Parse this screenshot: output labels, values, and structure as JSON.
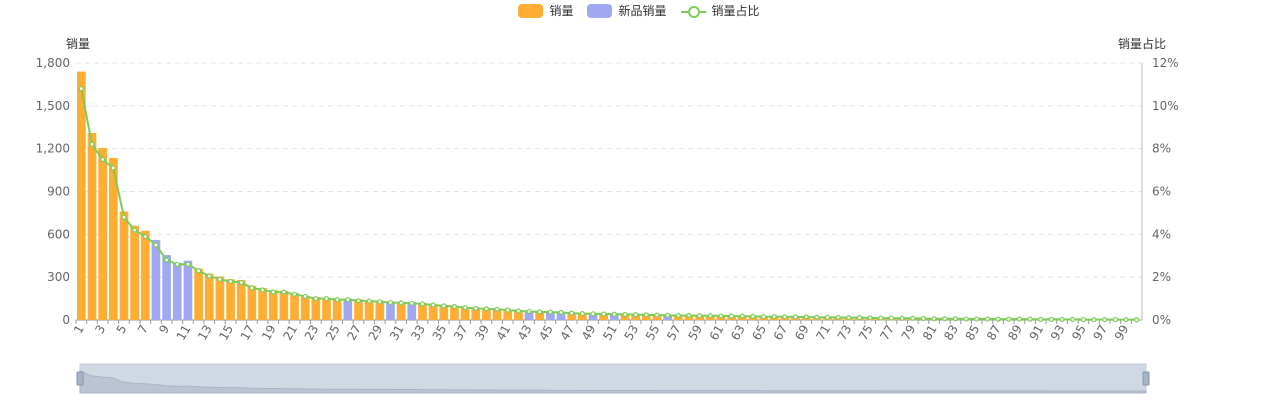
{
  "legend": {
    "sales_label": "销量",
    "new_sales_label": "新品销量",
    "ratio_label": "销量占比"
  },
  "colors": {
    "sales": "#FFAD33",
    "new_sales": "#9FA8F0",
    "ratio": "#7CCD57"
  },
  "chart_data": {
    "type": "bar",
    "title": "",
    "ylabel": "销量",
    "y2label": "销量占比",
    "ylim": [
      0,
      1800
    ],
    "y2lim": [
      0,
      12
    ],
    "y_ticks": [
      "0",
      "300",
      "600",
      "900",
      "1,200",
      "1,500",
      "1,800"
    ],
    "y2_ticks": [
      "0%",
      "2%",
      "4%",
      "6%",
      "8%",
      "10%",
      "12%"
    ],
    "x_tick_labels": [
      "1",
      "3",
      "5",
      "7",
      "9",
      "11",
      "13",
      "15",
      "17",
      "19",
      "21",
      "23",
      "25",
      "27",
      "29",
      "31",
      "33",
      "35",
      "37",
      "39",
      "41",
      "43",
      "45",
      "47",
      "49",
      "51",
      "53",
      "55",
      "57",
      "59",
      "61",
      "63",
      "65",
      "67",
      "69",
      "71",
      "73",
      "75",
      "77",
      "79",
      "81",
      "83",
      "85",
      "87",
      "89",
      "91",
      "93",
      "95",
      "97",
      "99"
    ],
    "categories": [
      1,
      2,
      3,
      4,
      5,
      6,
      7,
      8,
      9,
      10,
      11,
      12,
      13,
      14,
      15,
      16,
      17,
      18,
      19,
      20,
      21,
      22,
      23,
      24,
      25,
      26,
      27,
      28,
      29,
      30,
      31,
      32,
      33,
      34,
      35,
      36,
      37,
      38,
      39,
      40,
      41,
      42,
      43,
      44,
      45,
      46,
      47,
      48,
      49,
      50,
      51,
      52,
      53,
      54,
      55,
      56,
      57,
      58,
      59,
      60,
      61,
      62,
      63,
      64,
      65,
      66,
      67,
      68,
      69,
      70,
      71,
      72,
      73,
      74,
      75,
      76,
      77,
      78,
      79,
      80,
      81,
      82,
      83,
      84,
      85,
      86,
      87,
      88,
      89,
      90,
      91,
      92,
      93,
      94,
      95,
      96,
      97,
      98,
      99,
      100
    ],
    "series": [
      {
        "name": "销量",
        "type": "bar",
        "values": [
          1740,
          1310,
          1205,
          1135,
          760,
          660,
          625,
          0,
          0,
          0,
          0,
          360,
          325,
          305,
          285,
          280,
          240,
          225,
          210,
          205,
          190,
          170,
          160,
          155,
          150,
          0,
          145,
          140,
          135,
          0,
          125,
          0,
          120,
          110,
          105,
          100,
          92,
          85,
          82,
          80,
          72,
          65,
          0,
          60,
          0,
          0,
          50,
          48,
          0,
          45,
          0,
          42,
          40,
          38,
          36,
          0,
          34,
          33,
          32,
          31,
          30,
          29,
          28,
          27,
          26,
          25,
          24,
          23,
          22,
          21,
          20,
          19,
          18,
          17,
          16,
          15,
          14,
          13,
          12,
          11,
          10,
          10,
          9,
          9,
          8,
          8,
          7,
          7,
          6,
          6,
          5,
          5,
          5,
          4,
          4,
          4,
          3,
          3,
          3,
          2
        ]
      },
      {
        "name": "新品销量",
        "type": "bar",
        "values": [
          0,
          0,
          0,
          0,
          0,
          0,
          0,
          560,
          455,
          400,
          415,
          0,
          0,
          0,
          0,
          0,
          0,
          0,
          0,
          0,
          0,
          0,
          0,
          0,
          0,
          150,
          0,
          0,
          0,
          130,
          0,
          125,
          0,
          0,
          0,
          0,
          0,
          0,
          0,
          0,
          0,
          0,
          62,
          0,
          58,
          55,
          0,
          0,
          46,
          0,
          44,
          0,
          0,
          0,
          0,
          35,
          0,
          0,
          0,
          0,
          0,
          0,
          0,
          0,
          0,
          0,
          0,
          0,
          0,
          0,
          0,
          0,
          0,
          0,
          0,
          0,
          0,
          0,
          0,
          0,
          0,
          0,
          0,
          0,
          0,
          0,
          0,
          0,
          0,
          0,
          0,
          0,
          0,
          0,
          0,
          0,
          0,
          0,
          0,
          0
        ]
      },
      {
        "name": "销量占比",
        "type": "line",
        "axis": "right",
        "values": [
          10.8,
          8.2,
          7.5,
          7.1,
          4.8,
          4.2,
          3.9,
          3.5,
          2.8,
          2.6,
          2.6,
          2.3,
          2.05,
          1.9,
          1.8,
          1.75,
          1.5,
          1.4,
          1.3,
          1.3,
          1.2,
          1.1,
          1.0,
          1.0,
          0.95,
          0.95,
          0.9,
          0.88,
          0.85,
          0.82,
          0.8,
          0.78,
          0.75,
          0.7,
          0.66,
          0.63,
          0.58,
          0.54,
          0.52,
          0.5,
          0.46,
          0.42,
          0.4,
          0.38,
          0.37,
          0.35,
          0.32,
          0.3,
          0.29,
          0.28,
          0.27,
          0.26,
          0.25,
          0.24,
          0.23,
          0.22,
          0.21,
          0.21,
          0.2,
          0.2,
          0.19,
          0.18,
          0.18,
          0.17,
          0.16,
          0.16,
          0.15,
          0.14,
          0.14,
          0.13,
          0.12,
          0.12,
          0.11,
          0.11,
          0.1,
          0.09,
          0.09,
          0.08,
          0.08,
          0.07,
          0.06,
          0.06,
          0.06,
          0.05,
          0.05,
          0.05,
          0.04,
          0.04,
          0.04,
          0.04,
          0.03,
          0.03,
          0.03,
          0.03,
          0.02,
          0.02,
          0.02,
          0.02,
          0.02,
          0.01
        ]
      }
    ],
    "grid": true,
    "legend_position": "top-center",
    "data_zoom": true
  }
}
